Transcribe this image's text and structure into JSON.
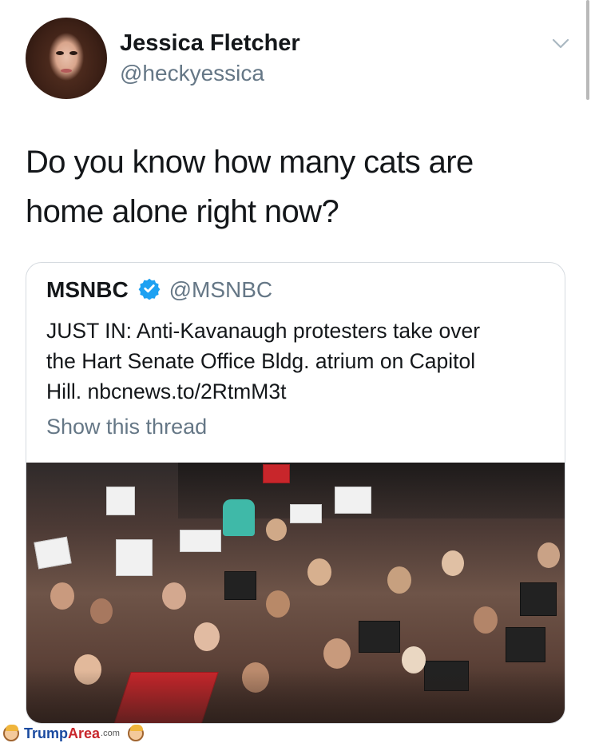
{
  "tweet": {
    "author": {
      "name": "Jessica Fletcher",
      "handle": "@heckyessica"
    },
    "text_line1": "Do you know how many cats are",
    "text_line2": "home alone right now?"
  },
  "quoted_tweet": {
    "author": {
      "name": "MSNBC",
      "handle": "@MSNBC",
      "verified": true
    },
    "text_line1": "JUST IN: Anti-Kavanaugh protesters take over",
    "text_line2": "the Hart Senate Office Bldg. atrium on Capitol",
    "text_line3": "Hill. nbcnews.to/2RtmM3t",
    "show_thread": "Show this thread",
    "media": "photo-crowd-protest"
  },
  "watermark": {
    "part1": "Trump",
    "part2": "Area",
    "part3": ".com"
  },
  "colors": {
    "text": "#14171a",
    "secondary": "#657786",
    "verified": "#1da1f2",
    "border": "#d6dbe0"
  },
  "icons": {
    "menu": "chevron-down-icon",
    "verified": "verified-badge-icon"
  }
}
